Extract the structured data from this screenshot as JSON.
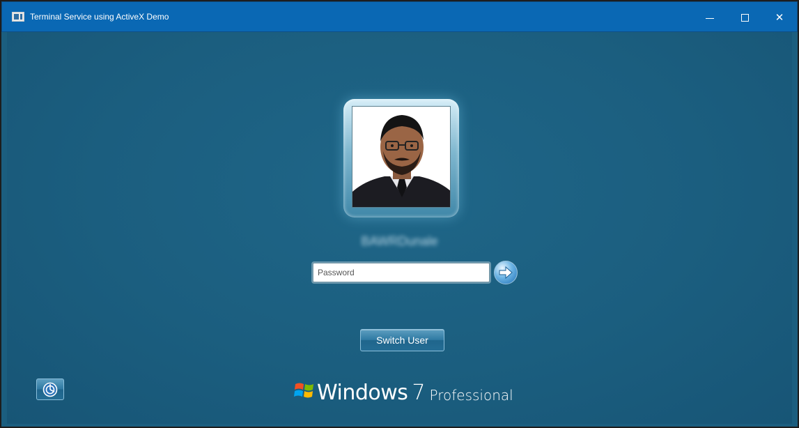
{
  "window": {
    "title": "Terminal Service using ActiveX Demo",
    "controls": {
      "minimize_icon": "minimize-icon",
      "maximize_icon": "maximize-icon",
      "close_glyph": "✕"
    },
    "titlebar_color": "#0a68b4"
  },
  "login": {
    "username": "BAWRDunale",
    "password_placeholder": "Password",
    "password_value": "",
    "go_icon": "arrow-right-icon",
    "switch_user_label": "Switch User",
    "ease_of_access_icon": "ease-of-access-icon",
    "background_color": "#1b5e7f"
  },
  "branding": {
    "word": "Windows",
    "version": "7",
    "edition": "Professional"
  }
}
